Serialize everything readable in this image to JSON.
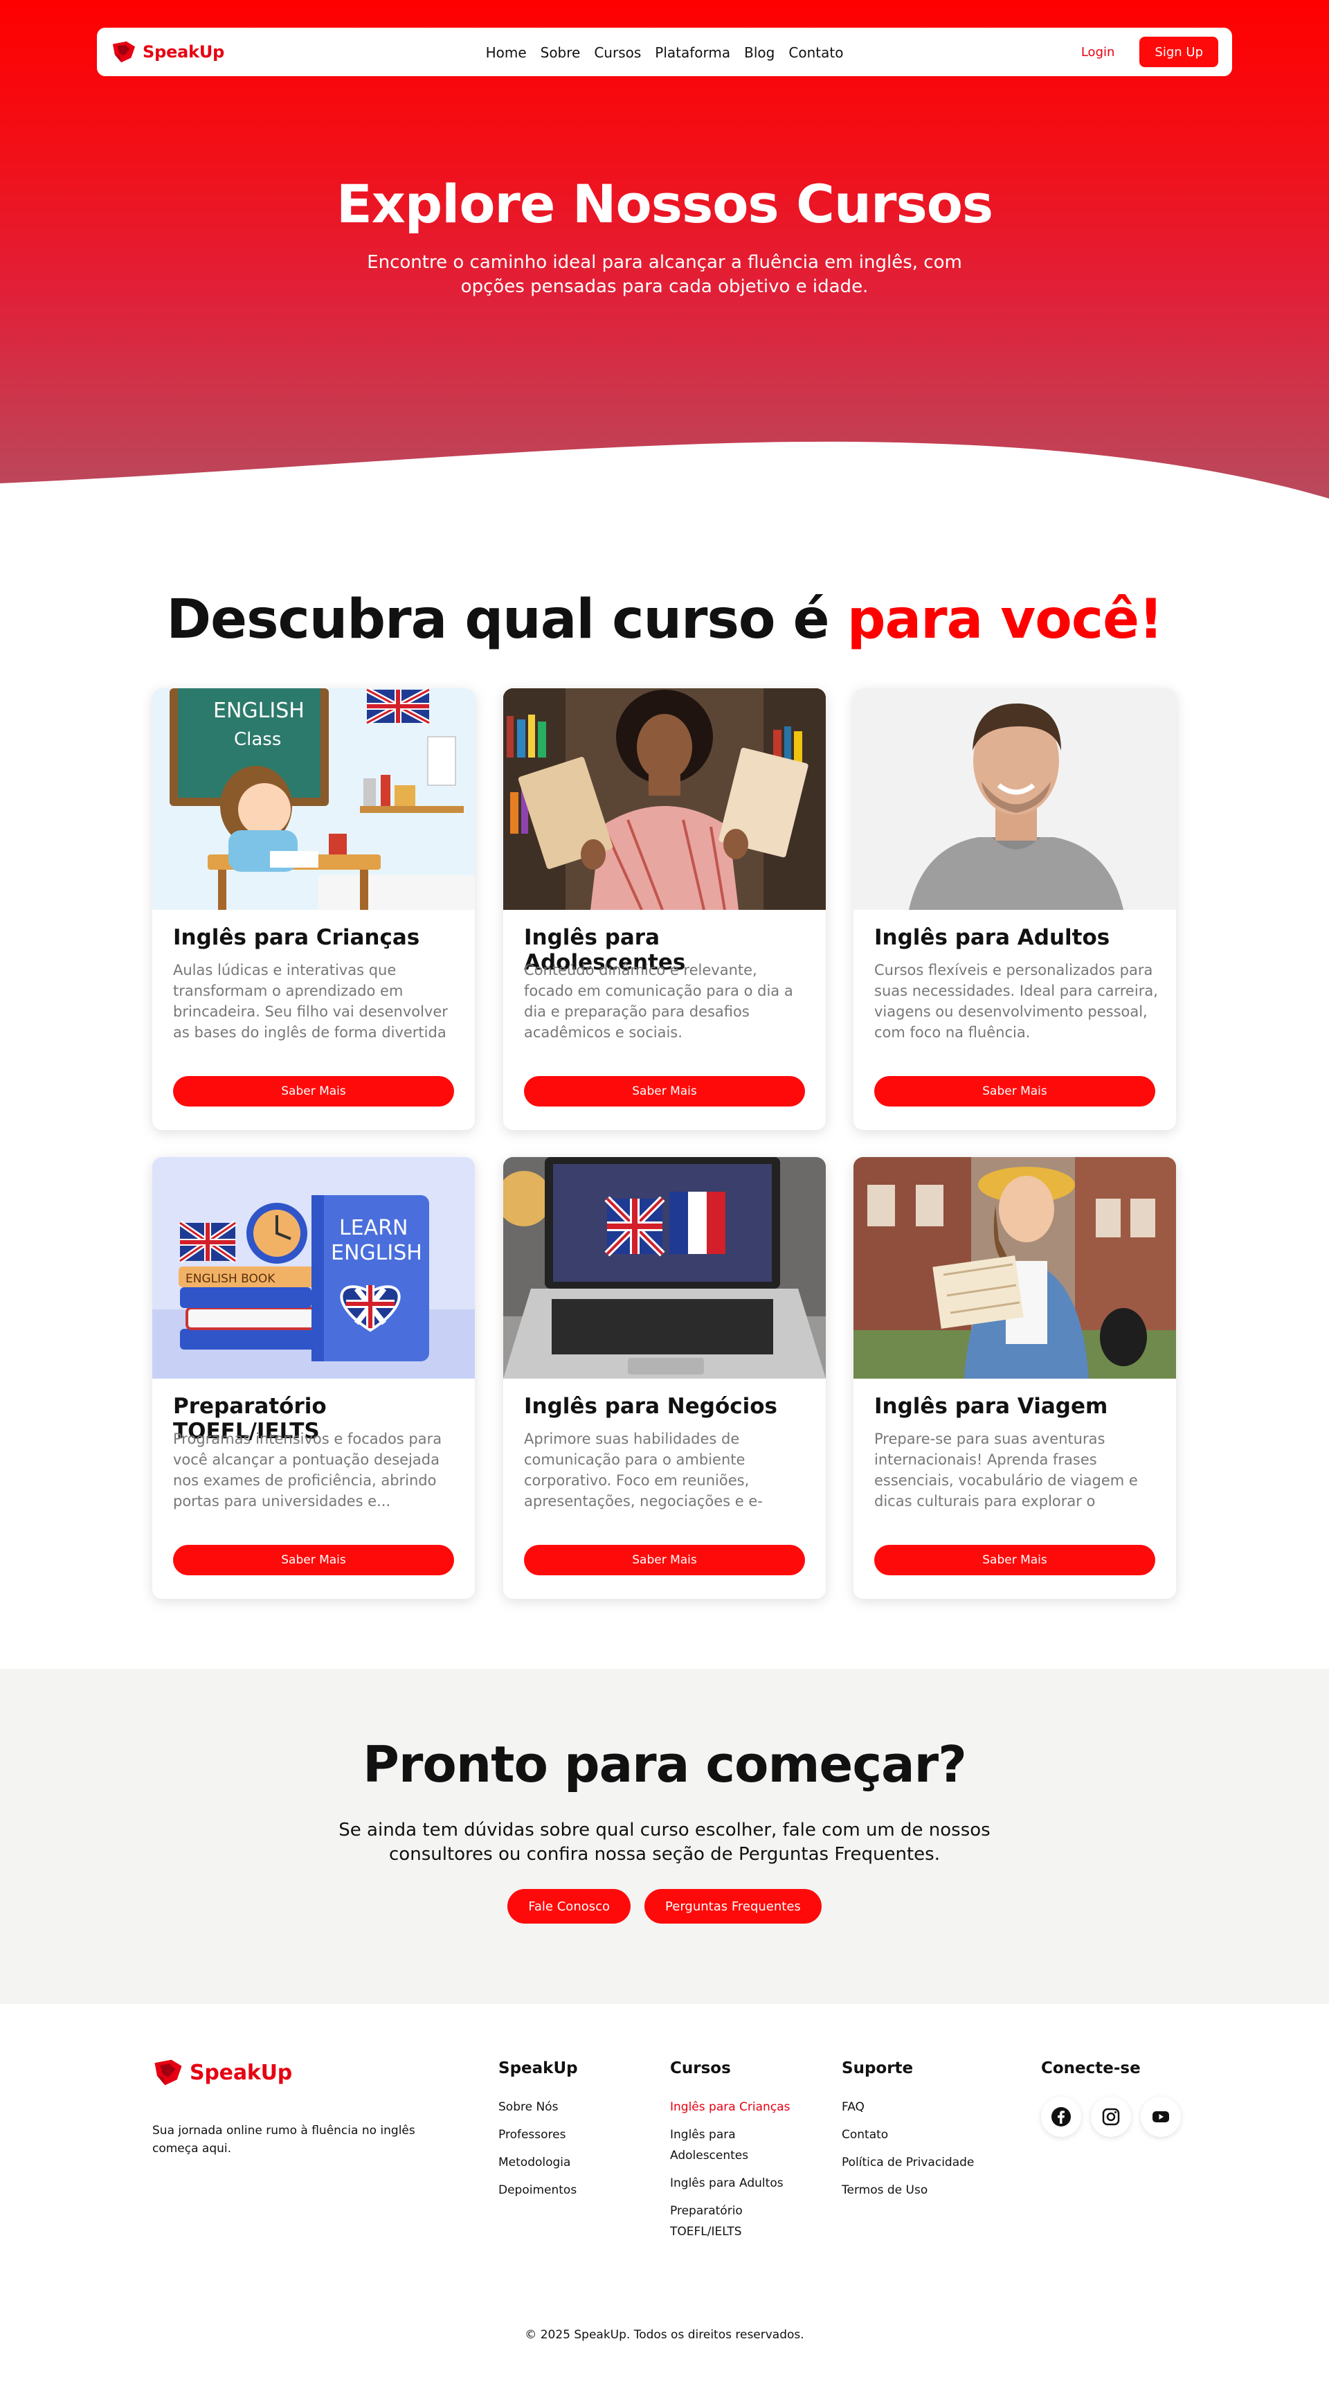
{
  "brand": {
    "name": "SpeakUp",
    "color": "#e60012"
  },
  "nav": {
    "links": [
      "Home",
      "Sobre",
      "Cursos",
      "Plataforma",
      "Blog",
      "Contato"
    ],
    "login": "Login",
    "signup": "Sign Up"
  },
  "hero": {
    "title": "Explore Nossos Cursos",
    "subtitle": "Encontre o caminho ideal para alcançar a fluência em inglês, com opções pensadas para cada objetivo e idade."
  },
  "courses": {
    "title_main": "Descubra qual curso é ",
    "title_accent": "para você!",
    "cards": [
      {
        "image": "girl-studying-english-class-illustration",
        "title": "Inglês para Crianças",
        "description": "Aulas lúdicas e interativas que transformam o aprendizado em brincadeira. Seu filho vai desenvolver as bases do inglês de forma divertida e...",
        "button": "Saber Mais"
      },
      {
        "image": "smiling-teen-holding-books-photo",
        "title": "Inglês para Adolescentes",
        "description": "Conteúdo dinâmico e relevante, focado em comunicação para o dia a dia e preparação para desafios acadêmicos e sociais.",
        "button": "Saber Mais"
      },
      {
        "image": "smiling-adult-man-photo",
        "title": "Inglês para Adultos",
        "description": "Cursos flexíveis e personalizados para suas necessidades. Ideal para carreira, viagens ou desenvolvimento pessoal, com foco na fluência.",
        "button": "Saber Mais"
      },
      {
        "image": "learn-english-books-clock-illustration",
        "title": "Preparatório TOEFL/IELTS",
        "description": "Programas intensivos e focados para você alcançar a pontuação desejada nos exames de proficiência, abrindo portas para universidades e...",
        "button": "Saber Mais"
      },
      {
        "image": "laptop-with-uk-and-france-flags-photo",
        "title": "Inglês para Negócios",
        "description": "Aprimore suas habilidades de comunicação para o ambiente corporativo. Foco em reuniões, apresentações, negociações e e-mails...",
        "button": "Saber Mais"
      },
      {
        "image": "traveler-woman-with-map-photo",
        "title": "Inglês para Viagem",
        "description": "Prepare-se para suas aventuras internacionais! Aprenda frases essenciais, vocabulário de viagem e dicas culturais para explorar o mundo...",
        "button": "Saber Mais"
      }
    ]
  },
  "cta": {
    "title": "Pronto para começar?",
    "text": "Se ainda tem dúvidas sobre qual curso escolher, fale com um de nossos consultores ou confira nossa seção de Perguntas Frequentes.",
    "contact_button": "Fale Conosco",
    "faq_button": "Perguntas Frequentes"
  },
  "footer": {
    "tagline": "Sua jornada online rumo à fluência no inglês começa aqui.",
    "columns": [
      {
        "title": "SpeakUp",
        "items": [
          "Sobre Nós",
          "Professores",
          "Metodologia",
          "Depoimentos"
        ]
      },
      {
        "title": "Cursos",
        "items": [
          "Inglês para Crianças",
          "Inglês para Adolescentes",
          "Inglês para Adultos",
          "Preparatório TOEFL/IELTS"
        ],
        "active_index": 0
      },
      {
        "title": "Suporte",
        "items": [
          "FAQ",
          "Contato",
          "Política de Privacidade",
          "Termos de Uso"
        ]
      }
    ],
    "social_title": "Conecte-se",
    "social_icons": [
      "facebook-icon",
      "instagram-icon",
      "youtube-icon"
    ],
    "copyright": "© 2025 SpeakUp. Todos os direitos reservados."
  },
  "colors": {
    "primary": "#ff0a0a",
    "hero_top": "#ff0000",
    "hero_bottom": "#b94a5d",
    "cta_background": "#f4f4f2"
  }
}
